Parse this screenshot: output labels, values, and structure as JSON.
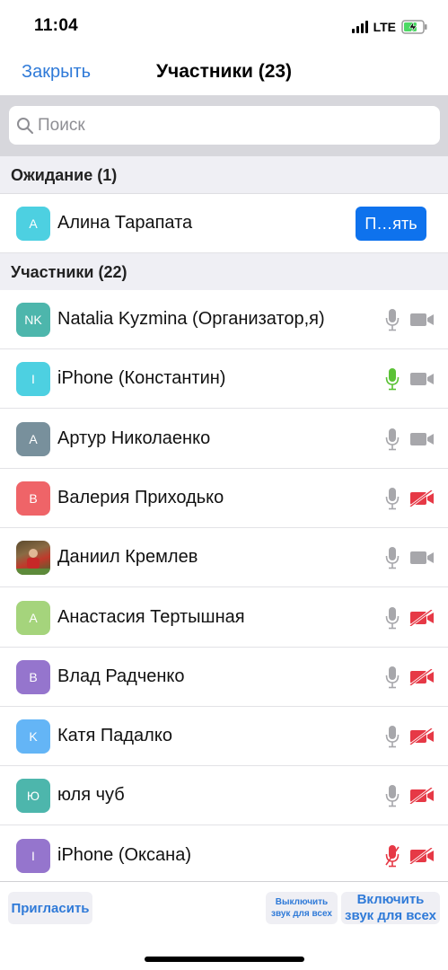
{
  "status_bar": {
    "time": "11:04",
    "network": "LTE",
    "battery_icon": "battery-charging-icon",
    "signal_icon": "signal-bars-icon"
  },
  "nav": {
    "close_label": "Закрыть",
    "title": "Участники (23)"
  },
  "search": {
    "placeholder": "Поиск",
    "value": ""
  },
  "waiting": {
    "header": "Ожидание (1)",
    "items": [
      {
        "initials": "A",
        "avatar_color": "#4dd0e1",
        "name": "Алина Тарапата",
        "admit_label": "П…ять"
      }
    ]
  },
  "participants": {
    "header": "Участники (22)",
    "items": [
      {
        "initials": "NK",
        "avatar_color": "#4db6ac",
        "name": "Natalia Kyzmina (Организатор,я)",
        "mic": "on",
        "video": "on"
      },
      {
        "initials": "I",
        "avatar_color": "#4dd0e1",
        "name": "iPhone (Константин)",
        "mic": "speaking",
        "video": "on"
      },
      {
        "initials": "A",
        "avatar_color": "#78909c",
        "name": "Артур Николаенко",
        "mic": "on",
        "video": "on"
      },
      {
        "initials": "B",
        "avatar_color": "#ef6468",
        "name": "Валерия Приходько",
        "mic": "on",
        "video": "off"
      },
      {
        "initials": "",
        "avatar_color": "#8a6b44",
        "name": "Даниил Кремлев",
        "mic": "on",
        "video": "on",
        "photo": true
      },
      {
        "initials": "A",
        "avatar_color": "#a5d47c",
        "name": "Анастасия Тертышная",
        "mic": "on",
        "video": "off"
      },
      {
        "initials": "B",
        "avatar_color": "#9575cd",
        "name": "Влад Радченко",
        "mic": "on",
        "video": "off"
      },
      {
        "initials": "K",
        "avatar_color": "#64b5f6",
        "name": "Катя Падалко",
        "mic": "on",
        "video": "off"
      },
      {
        "initials": "Ю",
        "avatar_color": "#4db6ac",
        "name": "юля чуб",
        "mic": "on",
        "video": "off"
      },
      {
        "initials": "I",
        "avatar_color": "#9575cd",
        "name": "iPhone (Оксана)",
        "mic": "off",
        "video": "off"
      }
    ]
  },
  "bottom": {
    "invite_label": "Пригласить",
    "mute_all_label": "Выключить звук для всех",
    "unmute_all_label": "Включить звук для всех"
  },
  "colors": {
    "accent": "#2f7ad8",
    "admit_button": "#0e72ed",
    "muted_red": "#e63946",
    "speaking_green": "#5bc236",
    "icon_gray": "#a7a7ab"
  }
}
